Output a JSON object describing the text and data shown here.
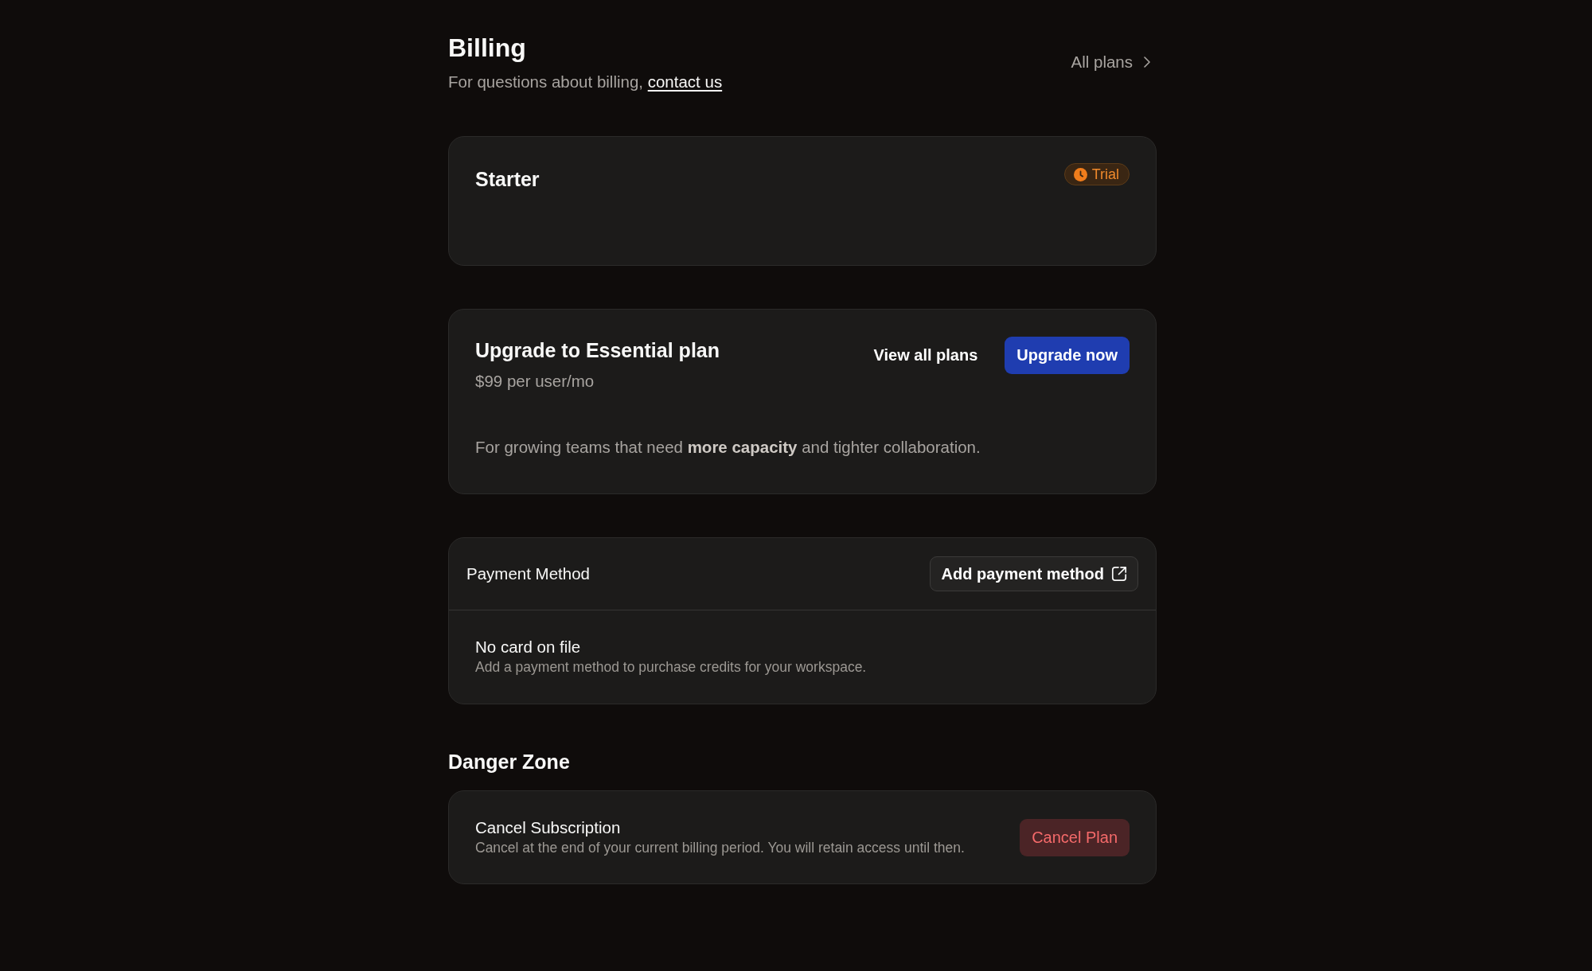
{
  "header": {
    "title": "Billing",
    "subtitle": "For questions about billing,",
    "contact_link": "contact us",
    "all_plans_link": "All plans"
  },
  "current_plan": {
    "name": "Starter",
    "badge": "Trial"
  },
  "upgrade": {
    "title": "Upgrade to Essential plan",
    "price": "$99 per user/mo",
    "description": "For growing teams that need **more capacity** and tighter collaboration.",
    "buttons": [
      {
        "label": "View all plans",
        "kind": "ghost"
      },
      {
        "label": "Upgrade now",
        "kind": "primary"
      }
    ]
  },
  "payment_method": {
    "title": "Payment Method",
    "button": {
      "label": "Add payment method",
      "kind": "outline"
    },
    "empty_title": "No card on file",
    "empty_description": "Add a payment method to purchase credits for your workspace."
  },
  "danger_zone": {
    "title": "Danger Zone",
    "items": [
      {
        "title": "Cancel Subscription",
        "description": "Cancel at the end of your current billing period. You will retain access until then.",
        "button": {
          "label": "Cancel Plan",
          "kind": "danger"
        }
      }
    ]
  }
}
